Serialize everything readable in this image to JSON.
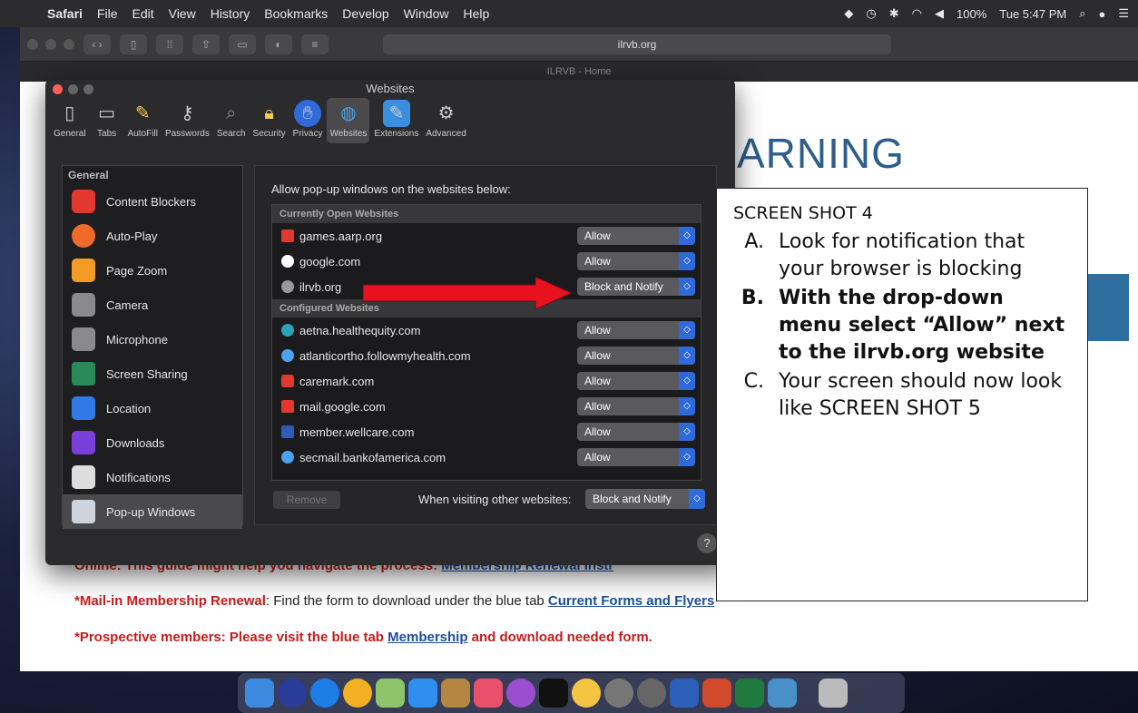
{
  "menubar": {
    "apple": "",
    "app": "Safari",
    "items": [
      "File",
      "Edit",
      "View",
      "History",
      "Bookmarks",
      "Develop",
      "Window",
      "Help"
    ],
    "battery": "100%",
    "clock": "Tue 5:47 PM"
  },
  "browser": {
    "address": "ilrvb.org",
    "tab_title": "ILRVB - Home"
  },
  "webpage": {
    "heading_fragment": "ARNING",
    "line1_prefix": "Online:  This guide might help you navigate the process: ",
    "line1_link": "Membership Renewal Instr",
    "line2_prefix": "*Mail-in Membership Renewal",
    "line2_middle": ":  Find the form to download under the blue tab ",
    "line2_link": "Current Forms and Flyers",
    "line3_prefix": "*Prospective members:  Please visit the blue tab ",
    "line3_link": "Membership",
    "line3_suffix": " and download needed form."
  },
  "prefs": {
    "title": "Websites",
    "tabs": [
      "General",
      "Tabs",
      "AutoFill",
      "Passwords",
      "Search",
      "Security",
      "Privacy",
      "Websites",
      "Extensions",
      "Advanced"
    ],
    "sidebar_heading": "General",
    "sidebar_items": [
      "Content Blockers",
      "Auto-Play",
      "Page Zoom",
      "Camera",
      "Microphone",
      "Screen Sharing",
      "Location",
      "Downloads",
      "Notifications",
      "Pop-up Windows"
    ],
    "panel_label": "Allow pop-up windows on the websites below:",
    "open_heading": "Currently Open Websites",
    "open_sites": [
      {
        "site": "games.aarp.org",
        "setting": "Allow"
      },
      {
        "site": "google.com",
        "setting": "Allow"
      },
      {
        "site": "ilrvb.org",
        "setting": "Block and Notify"
      }
    ],
    "configured_heading": "Configured Websites",
    "configured_sites": [
      {
        "site": "aetna.healthequity.com",
        "setting": "Allow"
      },
      {
        "site": "atlanticortho.followmyhealth.com",
        "setting": "Allow"
      },
      {
        "site": "caremark.com",
        "setting": "Allow"
      },
      {
        "site": "mail.google.com",
        "setting": "Allow"
      },
      {
        "site": "member.wellcare.com",
        "setting": "Allow"
      },
      {
        "site": "secmail.bankofamerica.com",
        "setting": "Allow"
      }
    ],
    "remove_label": "Remove",
    "visit_label": "When visiting other websites:",
    "visit_setting": "Block and Notify",
    "help_label": "?"
  },
  "callout": {
    "title": "SCREEN SHOT 4",
    "a_letter": "A.",
    "a_text": "Look for notification that your browser is blocking",
    "b_letter": "B.",
    "b_text": "With the drop-down menu select “Allow” next to the ilrvb.org website",
    "c_letter": "C.",
    "c_text": "Your screen should now look like SCREEN SHOT 5"
  },
  "colors": {
    "arrow": "#e8121f",
    "accent": "#2f6ad8"
  }
}
